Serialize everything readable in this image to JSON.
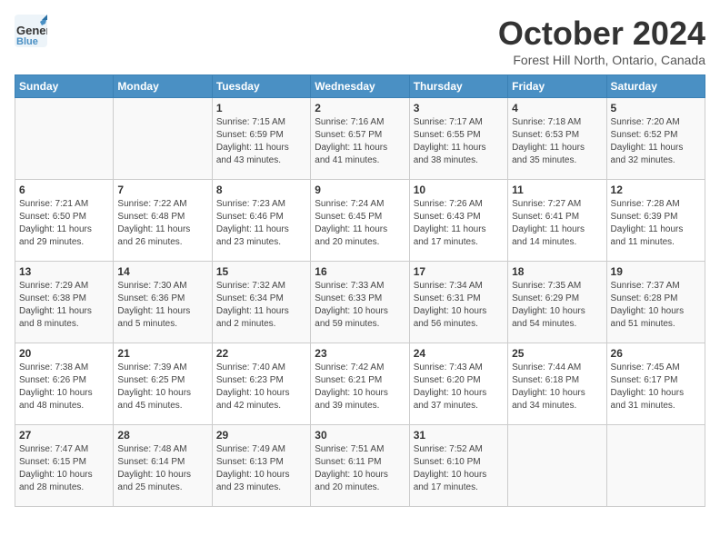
{
  "header": {
    "logo_line1": "General",
    "logo_line2": "Blue",
    "month_title": "October 2024",
    "location": "Forest Hill North, Ontario, Canada"
  },
  "days_of_week": [
    "Sunday",
    "Monday",
    "Tuesday",
    "Wednesday",
    "Thursday",
    "Friday",
    "Saturday"
  ],
  "weeks": [
    [
      {
        "day": "",
        "detail": ""
      },
      {
        "day": "",
        "detail": ""
      },
      {
        "day": "1",
        "detail": "Sunrise: 7:15 AM\nSunset: 6:59 PM\nDaylight: 11 hours\nand 43 minutes."
      },
      {
        "day": "2",
        "detail": "Sunrise: 7:16 AM\nSunset: 6:57 PM\nDaylight: 11 hours\nand 41 minutes."
      },
      {
        "day": "3",
        "detail": "Sunrise: 7:17 AM\nSunset: 6:55 PM\nDaylight: 11 hours\nand 38 minutes."
      },
      {
        "day": "4",
        "detail": "Sunrise: 7:18 AM\nSunset: 6:53 PM\nDaylight: 11 hours\nand 35 minutes."
      },
      {
        "day": "5",
        "detail": "Sunrise: 7:20 AM\nSunset: 6:52 PM\nDaylight: 11 hours\nand 32 minutes."
      }
    ],
    [
      {
        "day": "6",
        "detail": "Sunrise: 7:21 AM\nSunset: 6:50 PM\nDaylight: 11 hours\nand 29 minutes."
      },
      {
        "day": "7",
        "detail": "Sunrise: 7:22 AM\nSunset: 6:48 PM\nDaylight: 11 hours\nand 26 minutes."
      },
      {
        "day": "8",
        "detail": "Sunrise: 7:23 AM\nSunset: 6:46 PM\nDaylight: 11 hours\nand 23 minutes."
      },
      {
        "day": "9",
        "detail": "Sunrise: 7:24 AM\nSunset: 6:45 PM\nDaylight: 11 hours\nand 20 minutes."
      },
      {
        "day": "10",
        "detail": "Sunrise: 7:26 AM\nSunset: 6:43 PM\nDaylight: 11 hours\nand 17 minutes."
      },
      {
        "day": "11",
        "detail": "Sunrise: 7:27 AM\nSunset: 6:41 PM\nDaylight: 11 hours\nand 14 minutes."
      },
      {
        "day": "12",
        "detail": "Sunrise: 7:28 AM\nSunset: 6:39 PM\nDaylight: 11 hours\nand 11 minutes."
      }
    ],
    [
      {
        "day": "13",
        "detail": "Sunrise: 7:29 AM\nSunset: 6:38 PM\nDaylight: 11 hours\nand 8 minutes."
      },
      {
        "day": "14",
        "detail": "Sunrise: 7:30 AM\nSunset: 6:36 PM\nDaylight: 11 hours\nand 5 minutes."
      },
      {
        "day": "15",
        "detail": "Sunrise: 7:32 AM\nSunset: 6:34 PM\nDaylight: 11 hours\nand 2 minutes."
      },
      {
        "day": "16",
        "detail": "Sunrise: 7:33 AM\nSunset: 6:33 PM\nDaylight: 10 hours\nand 59 minutes."
      },
      {
        "day": "17",
        "detail": "Sunrise: 7:34 AM\nSunset: 6:31 PM\nDaylight: 10 hours\nand 56 minutes."
      },
      {
        "day": "18",
        "detail": "Sunrise: 7:35 AM\nSunset: 6:29 PM\nDaylight: 10 hours\nand 54 minutes."
      },
      {
        "day": "19",
        "detail": "Sunrise: 7:37 AM\nSunset: 6:28 PM\nDaylight: 10 hours\nand 51 minutes."
      }
    ],
    [
      {
        "day": "20",
        "detail": "Sunrise: 7:38 AM\nSunset: 6:26 PM\nDaylight: 10 hours\nand 48 minutes."
      },
      {
        "day": "21",
        "detail": "Sunrise: 7:39 AM\nSunset: 6:25 PM\nDaylight: 10 hours\nand 45 minutes."
      },
      {
        "day": "22",
        "detail": "Sunrise: 7:40 AM\nSunset: 6:23 PM\nDaylight: 10 hours\nand 42 minutes."
      },
      {
        "day": "23",
        "detail": "Sunrise: 7:42 AM\nSunset: 6:21 PM\nDaylight: 10 hours\nand 39 minutes."
      },
      {
        "day": "24",
        "detail": "Sunrise: 7:43 AM\nSunset: 6:20 PM\nDaylight: 10 hours\nand 37 minutes."
      },
      {
        "day": "25",
        "detail": "Sunrise: 7:44 AM\nSunset: 6:18 PM\nDaylight: 10 hours\nand 34 minutes."
      },
      {
        "day": "26",
        "detail": "Sunrise: 7:45 AM\nSunset: 6:17 PM\nDaylight: 10 hours\nand 31 minutes."
      }
    ],
    [
      {
        "day": "27",
        "detail": "Sunrise: 7:47 AM\nSunset: 6:15 PM\nDaylight: 10 hours\nand 28 minutes."
      },
      {
        "day": "28",
        "detail": "Sunrise: 7:48 AM\nSunset: 6:14 PM\nDaylight: 10 hours\nand 25 minutes."
      },
      {
        "day": "29",
        "detail": "Sunrise: 7:49 AM\nSunset: 6:13 PM\nDaylight: 10 hours\nand 23 minutes."
      },
      {
        "day": "30",
        "detail": "Sunrise: 7:51 AM\nSunset: 6:11 PM\nDaylight: 10 hours\nand 20 minutes."
      },
      {
        "day": "31",
        "detail": "Sunrise: 7:52 AM\nSunset: 6:10 PM\nDaylight: 10 hours\nand 17 minutes."
      },
      {
        "day": "",
        "detail": ""
      },
      {
        "day": "",
        "detail": ""
      }
    ]
  ]
}
